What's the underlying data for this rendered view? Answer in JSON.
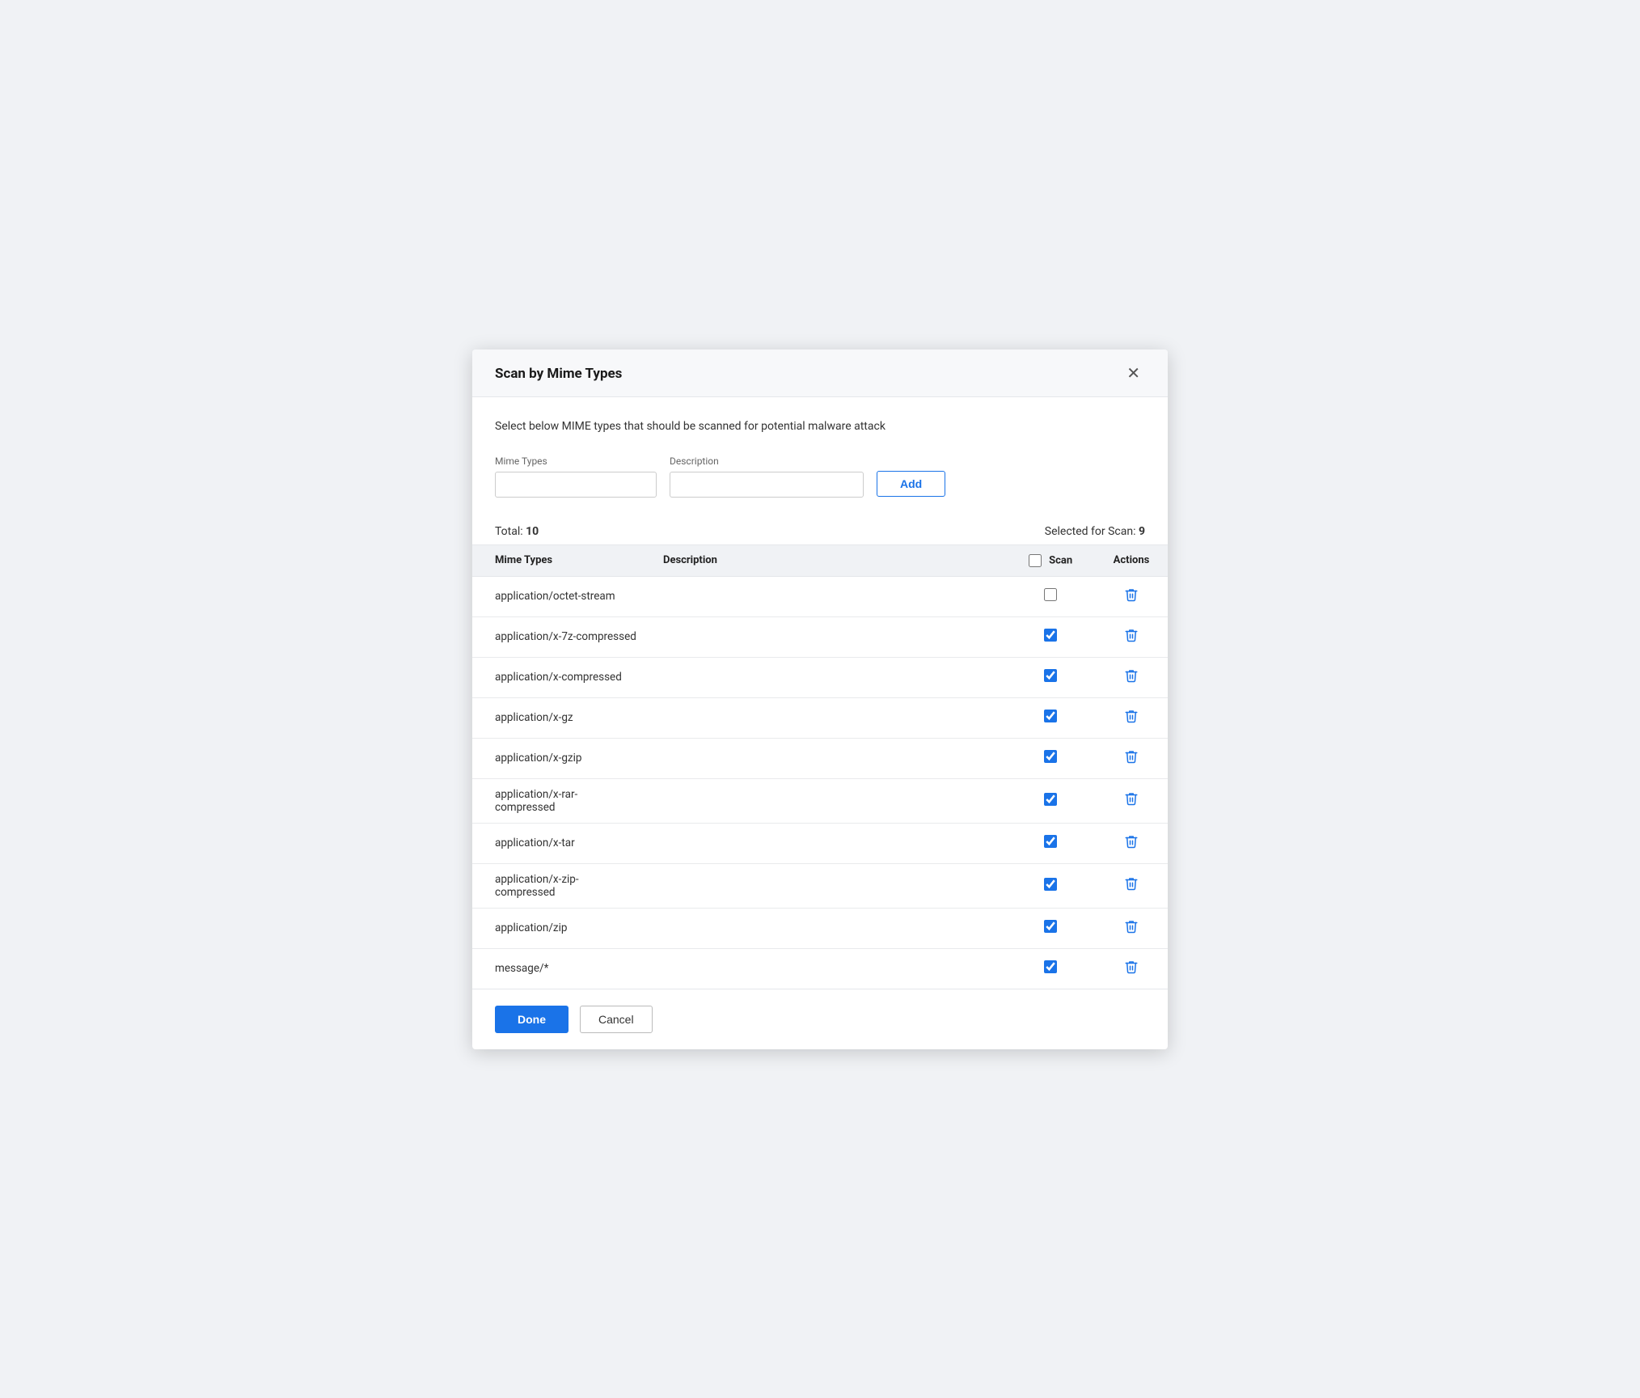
{
  "dialog": {
    "title": "Scan by Mime Types",
    "subtitle": "Select below MIME types that should be scanned for potential malware attack"
  },
  "form": {
    "mime_label": "Mime Types",
    "desc_label": "Description",
    "mime_placeholder": "",
    "desc_placeholder": "",
    "add_button": "Add"
  },
  "summary": {
    "total_label": "Total:",
    "total_value": "10",
    "selected_label": "Selected for Scan:",
    "selected_value": "9"
  },
  "table": {
    "col_mime": "Mime Types",
    "col_desc": "Description",
    "col_scan": "Scan",
    "col_actions": "Actions",
    "header_scan_checked": false
  },
  "rows": [
    {
      "mime": "application/octet-stream",
      "desc": "",
      "scan": false
    },
    {
      "mime": "application/x-7z-compressed",
      "desc": "",
      "scan": true
    },
    {
      "mime": "application/x-compressed",
      "desc": "",
      "scan": true
    },
    {
      "mime": "application/x-gz",
      "desc": "",
      "scan": true
    },
    {
      "mime": "application/x-gzip",
      "desc": "",
      "scan": true
    },
    {
      "mime": "application/x-rar-compressed",
      "desc": "",
      "scan": true
    },
    {
      "mime": "application/x-tar",
      "desc": "",
      "scan": true
    },
    {
      "mime": "application/x-zip-compressed",
      "desc": "",
      "scan": true
    },
    {
      "mime": "application/zip",
      "desc": "",
      "scan": true
    },
    {
      "mime": "message/*",
      "desc": "",
      "scan": true
    }
  ],
  "footer": {
    "done_label": "Done",
    "cancel_label": "Cancel"
  }
}
